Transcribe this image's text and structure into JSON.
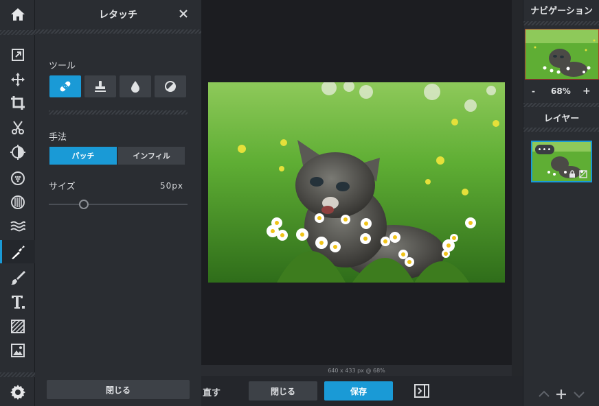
{
  "panel": {
    "title": "レタッチ",
    "tools_label": "ツール",
    "tools": [
      {
        "icon": "bandage-icon",
        "active": true
      },
      {
        "icon": "clone-stamp-icon",
        "active": false
      },
      {
        "icon": "drop-icon",
        "active": false
      },
      {
        "icon": "dodge-burn-icon",
        "active": false
      }
    ],
    "method_label": "手法",
    "method_options": [
      "パッチ",
      "インフィル"
    ],
    "method_selected": "パッチ",
    "size_label": "サイズ",
    "size_value": "50px",
    "size_slider_fraction": 0.25,
    "close_label": "閉じる"
  },
  "canvas": {
    "info": "640 x 433 px @ 68%"
  },
  "bottombar": {
    "redo_label": "直す",
    "close_label": "閉じる",
    "save_label": "保存"
  },
  "right_panel": {
    "navigation_title": "ナビゲーション",
    "zoom_minus": "-",
    "zoom_value": "68%",
    "zoom_plus": "+",
    "layers_title": "レイヤー",
    "layer_menu": "•••"
  },
  "rail_tools": [
    "home-icon",
    "export-icon",
    "move-icon",
    "crop-icon",
    "cut-icon",
    "adjust-icon",
    "filter-icon",
    "vignette-icon",
    "liquify-icon",
    "retouch-icon",
    "brush-icon",
    "text-icon",
    "pattern-icon",
    "image-icon",
    "settings-icon"
  ],
  "colors": {
    "accent": "#1a9ad6",
    "panel": "#2a2d32",
    "canvas": "#1c1d21",
    "navigator_border": "#b3362a"
  }
}
